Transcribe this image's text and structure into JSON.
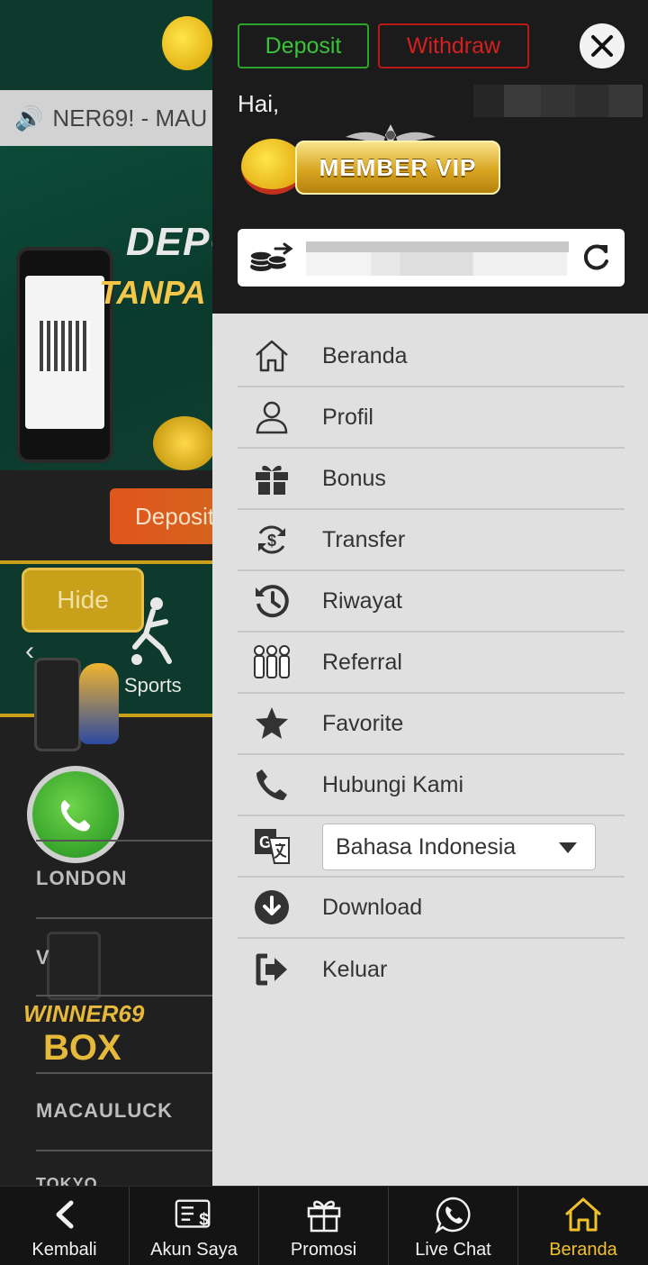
{
  "background": {
    "marquee_text": "NER69! - MAU",
    "banner_title": "DEPO",
    "banner_subtitle": "TANPA",
    "deposit_button": "Deposit",
    "hide_button": "Hide",
    "sports_label": "Sports",
    "city_london": "LONDON",
    "city_v": "V",
    "logo_line1": "WINNER69",
    "logo_line2": "BOX",
    "city_macauluck": "MACAULUCK",
    "city_tokyo": "TOKYO"
  },
  "drawer": {
    "deposit_label": "Deposit",
    "withdraw_label": "Withdraw",
    "greeting": "Hai,",
    "vip_badge": "MEMBER VIP",
    "menu": [
      {
        "label": "Beranda",
        "icon": "home-icon"
      },
      {
        "label": "Profil",
        "icon": "user-icon"
      },
      {
        "label": "Bonus",
        "icon": "gift-icon"
      },
      {
        "label": "Transfer",
        "icon": "transfer-icon"
      },
      {
        "label": "Riwayat",
        "icon": "history-icon"
      },
      {
        "label": "Referral",
        "icon": "referral-icon"
      },
      {
        "label": "Favorite",
        "icon": "star-icon"
      },
      {
        "label": "Hubungi Kami",
        "icon": "phone-icon"
      },
      {
        "label": "Bahasa Indonesia",
        "icon": "translate-icon"
      },
      {
        "label": "Download",
        "icon": "download-icon"
      },
      {
        "label": "Keluar",
        "icon": "logout-icon"
      }
    ]
  },
  "bottom_nav": [
    {
      "label": "Kembali",
      "icon": "back-icon"
    },
    {
      "label": "Akun Saya",
      "icon": "account-icon"
    },
    {
      "label": "Promosi",
      "icon": "promo-gift-icon"
    },
    {
      "label": "Live Chat",
      "icon": "whatsapp-icon"
    },
    {
      "label": "Beranda",
      "icon": "home-icon",
      "active": true
    }
  ],
  "colors": {
    "deposit_green": "#39c339",
    "withdraw_red": "#d42020",
    "active_nav": "#f0c12a",
    "drawer_bg": "#e0e0e0",
    "header_bg": "#1b1b1b"
  }
}
